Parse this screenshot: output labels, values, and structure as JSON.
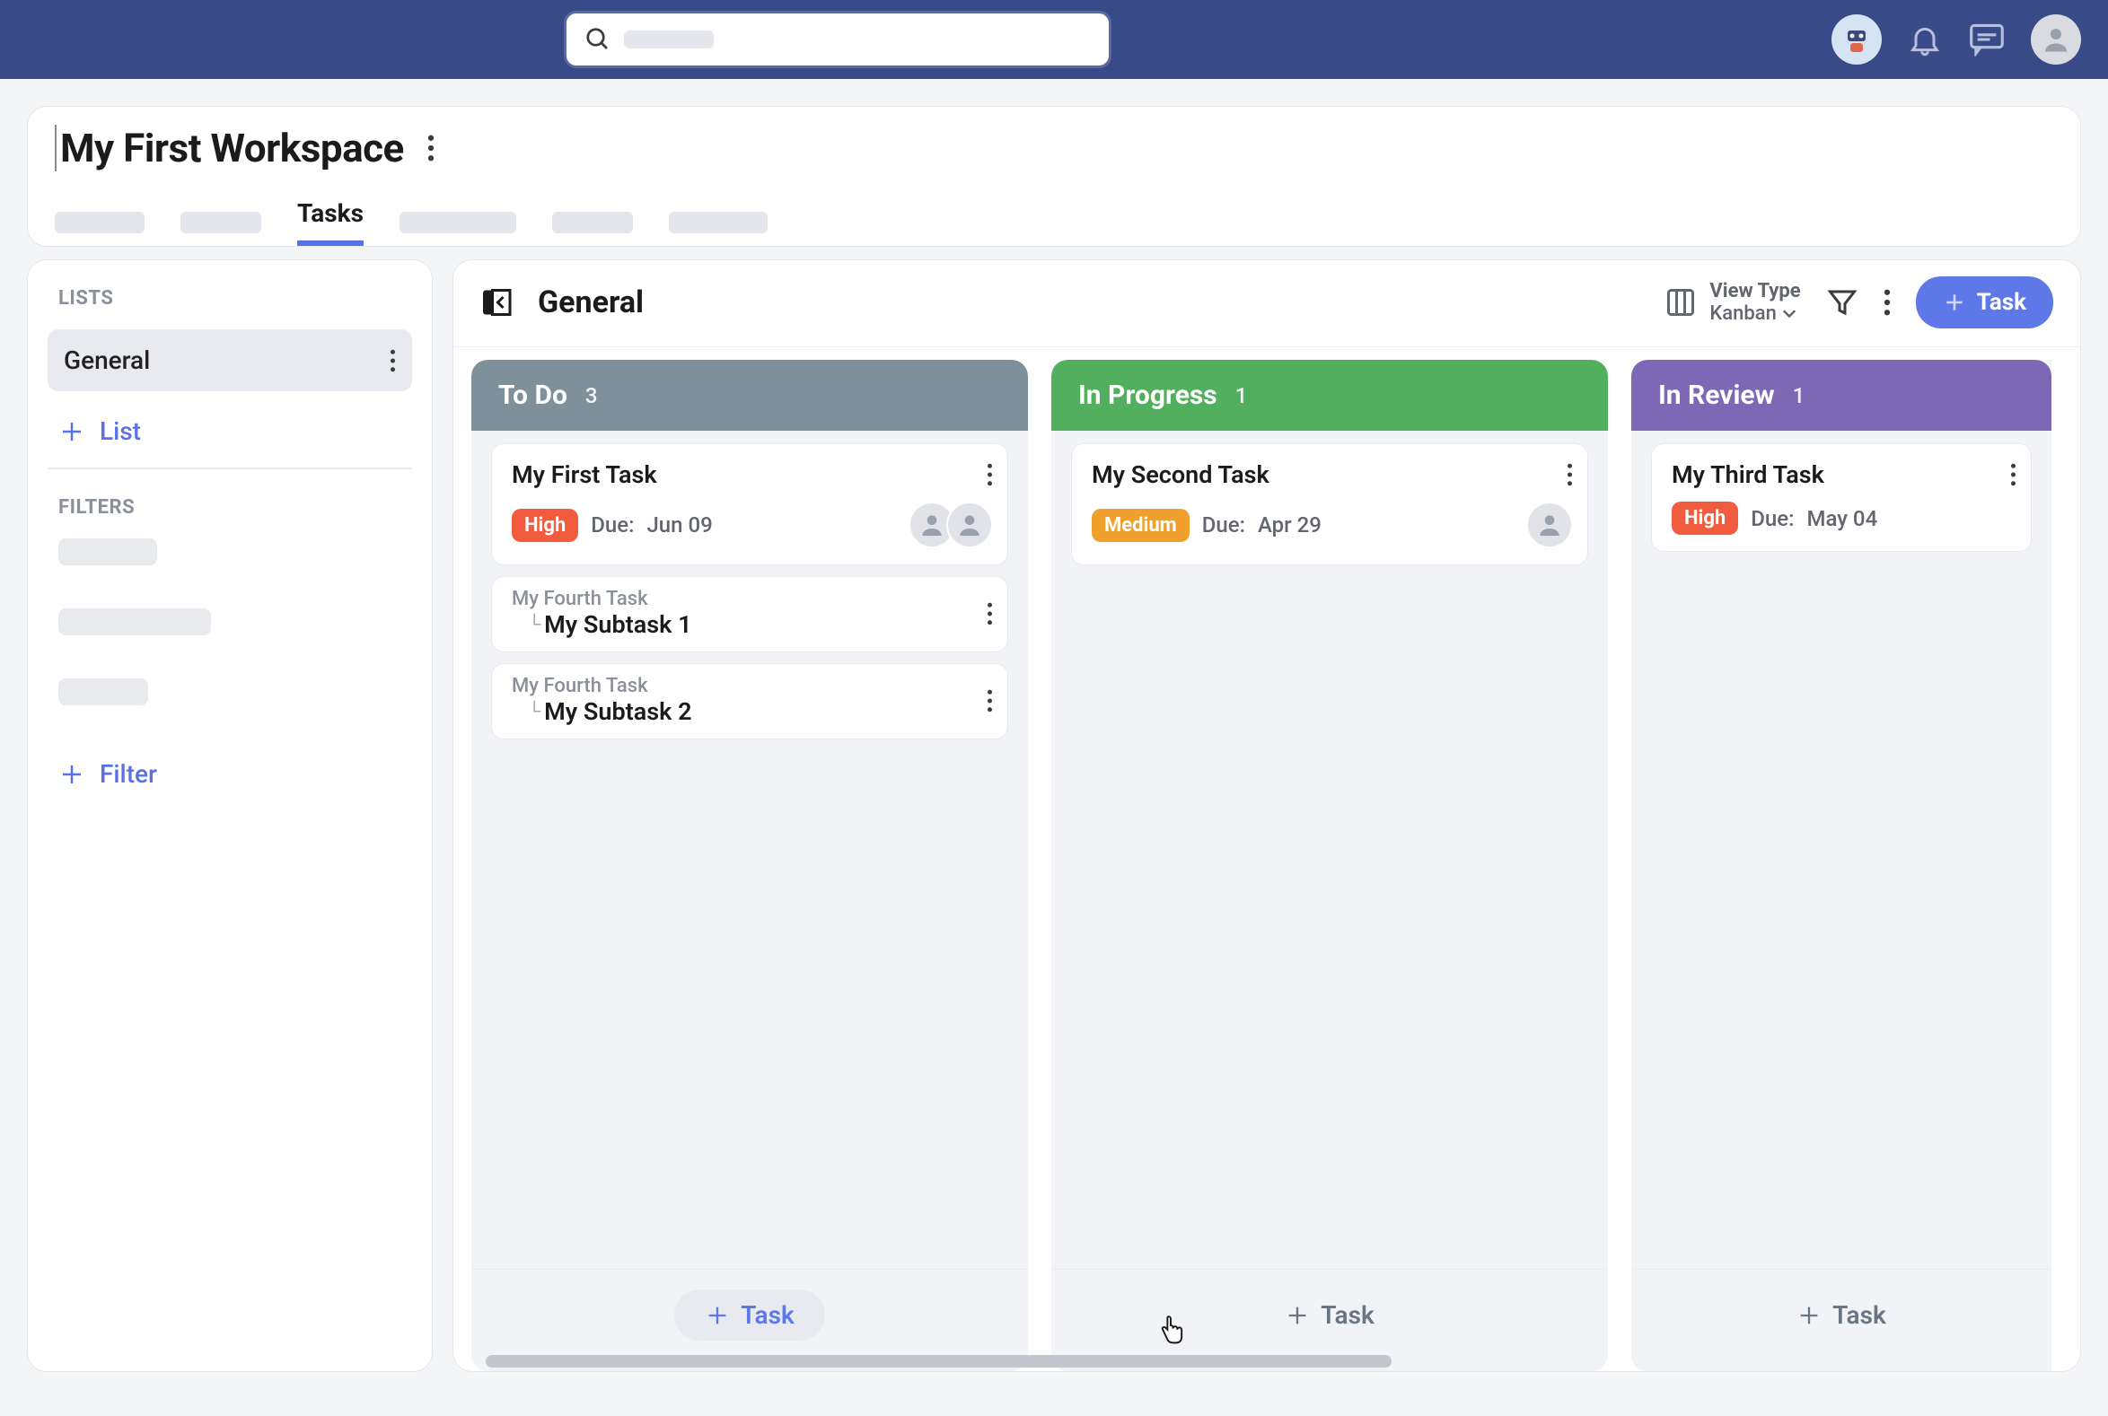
{
  "search": {
    "placeholder": ""
  },
  "workspace": {
    "title": "My First Workspace",
    "active_tab": "Tasks"
  },
  "sidebar": {
    "lists_heading": "LISTS",
    "filters_heading": "FILTERS",
    "active_list": "General",
    "add_list_label": "List",
    "add_filter_label": "Filter"
  },
  "board": {
    "title": "General",
    "viewtype_label": "View Type",
    "viewtype_value": "Kanban",
    "new_task_label": "Task",
    "add_task_label": "Task",
    "columns": [
      {
        "id": "todo",
        "title": "To Do",
        "count": "3",
        "header_class": "todo",
        "tasks": [
          {
            "title": "My First Task",
            "priority": "High",
            "priority_class": "high",
            "due_label": "Due:",
            "due_value": "Jun 09",
            "assignees": 2
          }
        ],
        "subtasks": [
          {
            "parent": "My Fourth Task",
            "title": "My Subtask 1"
          },
          {
            "parent": "My Fourth Task",
            "title": "My Subtask 2"
          }
        ],
        "footer_hover": true
      },
      {
        "id": "progress",
        "title": "In Progress",
        "count": "1",
        "header_class": "progress",
        "tasks": [
          {
            "title": "My Second Task",
            "priority": "Medium",
            "priority_class": "medium",
            "due_label": "Due:",
            "due_value": "Apr 29",
            "assignees": 1
          }
        ],
        "subtasks": [],
        "footer_hover": false
      },
      {
        "id": "review",
        "title": "In Review",
        "count": "1",
        "header_class": "review",
        "partial": true,
        "tasks": [
          {
            "title": "My Third Task",
            "priority": "High",
            "priority_class": "high",
            "due_label": "Due:",
            "due_value": "May 04",
            "assignees": 0
          }
        ],
        "subtasks": [],
        "footer_hover": false
      }
    ]
  }
}
